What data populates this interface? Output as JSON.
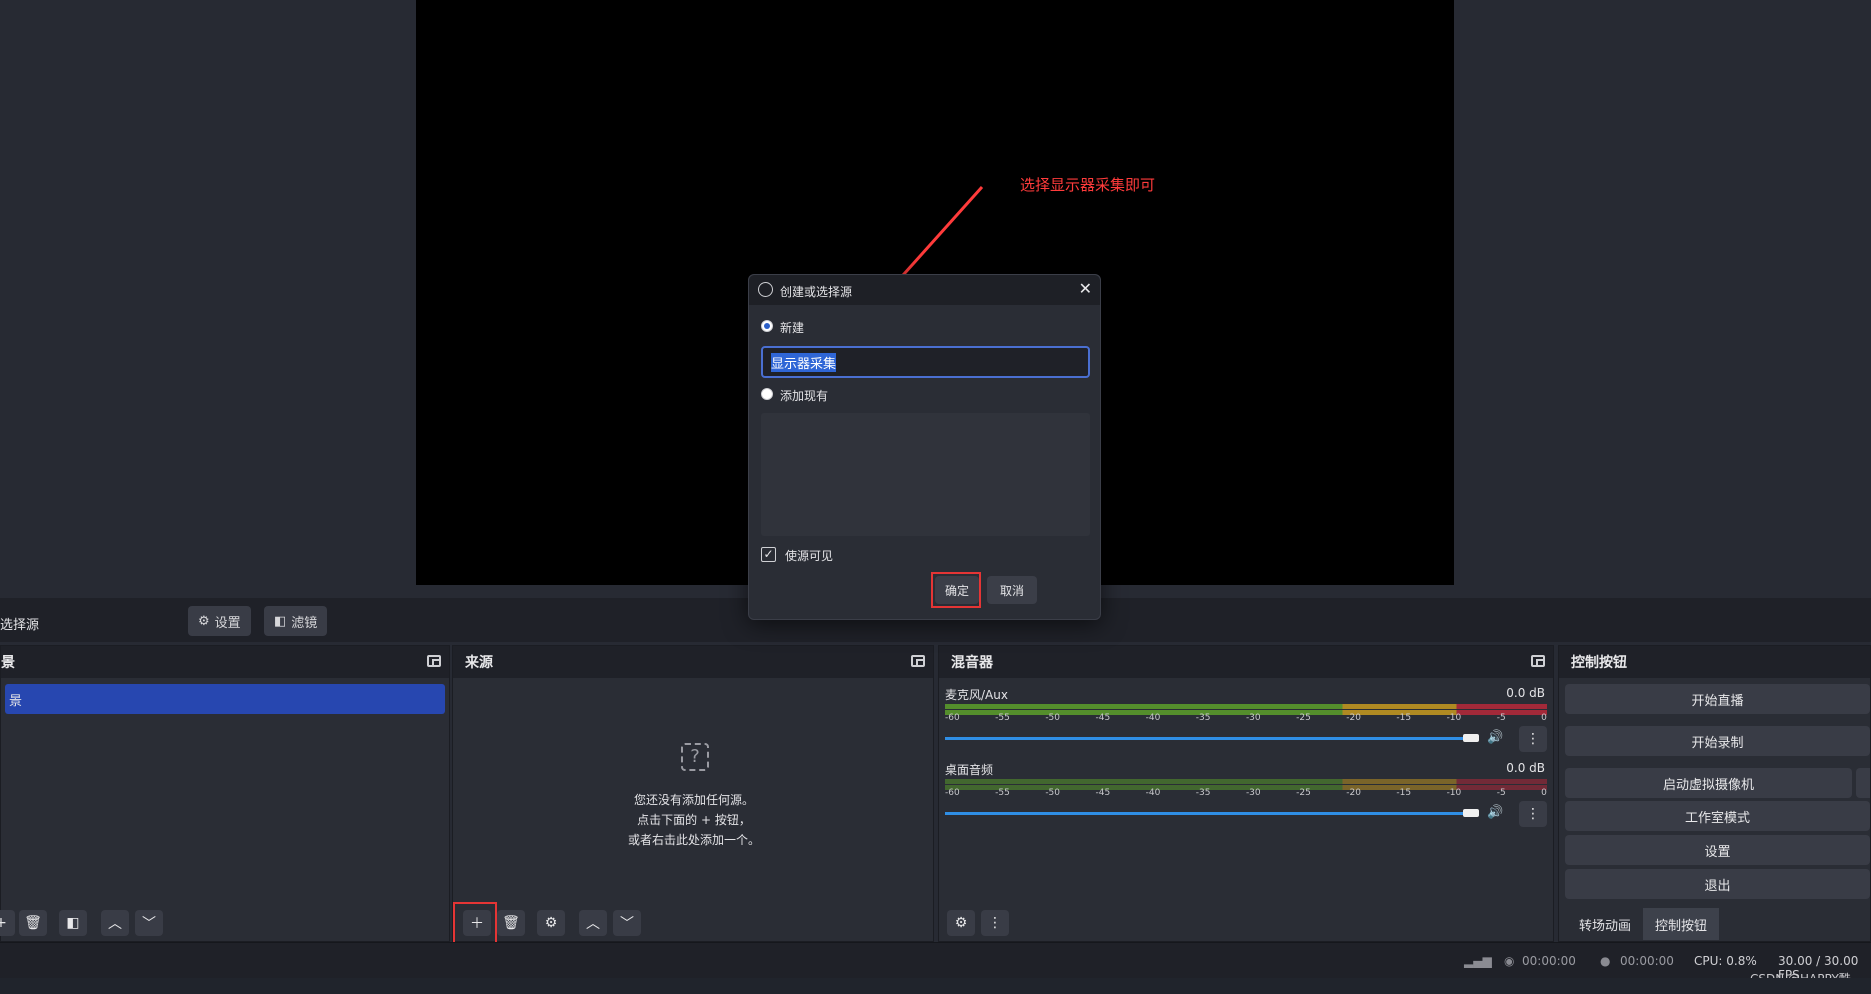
{
  "annotation": "选择显示器采集即可",
  "context_bar": {
    "label": "选择源",
    "settings_label": "设置",
    "filters_label": "滤镜"
  },
  "scenes_dock": {
    "title": "景",
    "selected_item": "景"
  },
  "sources_dock": {
    "title": "来源",
    "empty_line1": "您还没有添加任何源。",
    "empty_line2": "点击下面的 + 按钮，",
    "empty_line3": "或者右击此处添加一个。"
  },
  "mixer_dock": {
    "title": "混音器",
    "channels": [
      {
        "name": "麦克风/Aux",
        "db": "0.0 dB"
      },
      {
        "name": "桌面音频",
        "db": "0.0 dB"
      }
    ],
    "scale": [
      "-60",
      "-55",
      "-50",
      "-45",
      "-40",
      "-35",
      "-30",
      "-25",
      "-20",
      "-15",
      "-10",
      "-5",
      "0"
    ]
  },
  "controls_dock": {
    "title": "控制按钮",
    "start_stream": "开始直播",
    "start_record": "开始录制",
    "virtual_cam": "启动虚拟摄像机",
    "studio_mode": "工作室模式",
    "settings": "设置",
    "exit": "退出",
    "tab_transitions": "转场动画",
    "tab_controls": "控制按钮"
  },
  "status": {
    "stream_time": "00:00:00",
    "record_time": "00:00:00",
    "cpu": "CPU: 0.8%",
    "fps": "30.00 / 30.00 FPS",
    "watermark": "CSDN @HAPPY酷"
  },
  "dialog": {
    "title": "创建或选择源",
    "new_label": "新建",
    "name_value": "显示器采集",
    "add_existing_label": "添加现有",
    "visible_label": "使源可见",
    "ok_label": "确定",
    "cancel_label": "取消"
  },
  "colors": {
    "accent": "#2747b0",
    "highlight": "#e53535"
  }
}
